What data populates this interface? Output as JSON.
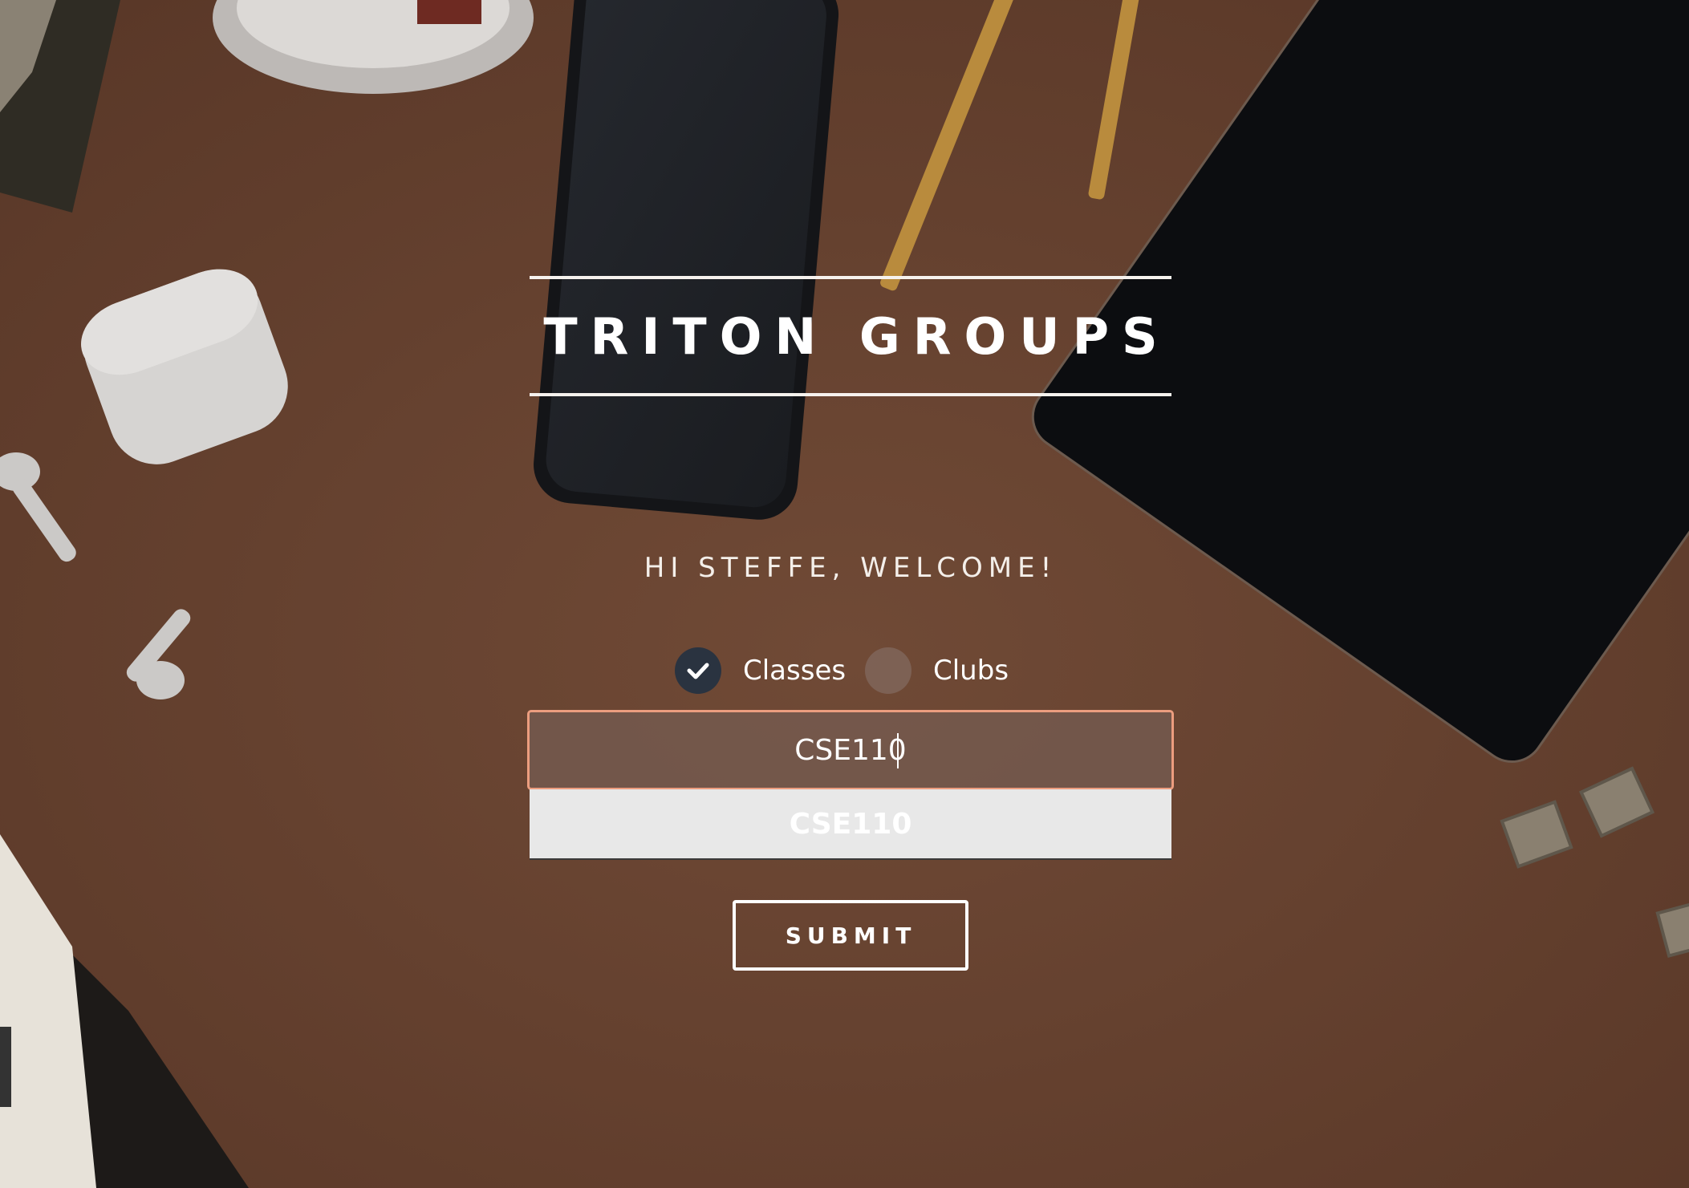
{
  "app": {
    "title": "TRITON GROUPS"
  },
  "welcome": {
    "text": "HI STEFFE, WELCOME!"
  },
  "category_toggle": {
    "options": [
      {
        "label": "Classes",
        "selected": true
      },
      {
        "label": "Clubs",
        "selected": false
      }
    ]
  },
  "search": {
    "value": "CSE110",
    "placeholder": ""
  },
  "suggestions": [
    "CSE110"
  ],
  "actions": {
    "submit_label": "SUBMIT"
  },
  "icons": {
    "selected_indicator": "check-icon"
  },
  "colors": {
    "background": "#6b4532",
    "input_border": "#ec9d7f",
    "radio_checked": "#2a3340",
    "suggestion_bg": "#e8e8e8"
  }
}
